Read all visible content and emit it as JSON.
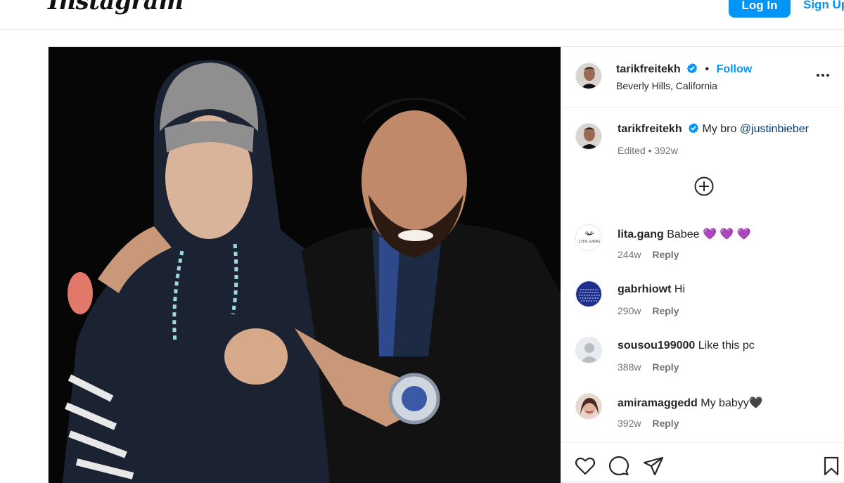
{
  "header": {
    "logo_text": "Instagram",
    "login_label": "Log In",
    "signup_label": "Sign Up"
  },
  "post": {
    "username": "tarikfreitekh",
    "verified": true,
    "follow_label": "Follow",
    "separator": "•",
    "location": "Beverly Hills, California",
    "caption": {
      "username": "tarikfreitekh",
      "text": "My bro",
      "mention": "@justinbieber",
      "edited_label": "Edited",
      "time": "392w"
    }
  },
  "comments": [
    {
      "username": "lita.gang",
      "text": "Babee",
      "emoji": "💜 💜 💜",
      "time": "244w",
      "reply_label": "Reply",
      "avatar_text": "LITA GANG"
    },
    {
      "username": "gabrhiowt",
      "text": "Hi",
      "emoji": "",
      "time": "290w",
      "reply_label": "Reply"
    },
    {
      "username": "sousou199000",
      "text": "Like this pc",
      "emoji": "",
      "time": "388w",
      "reply_label": "Reply"
    },
    {
      "username": "amiramaggedd",
      "text": "My babyy",
      "emoji": "🖤",
      "time": "392w",
      "reply_label": "Reply"
    }
  ],
  "icons": {
    "more": "more-options-icon",
    "load_more": "plus-circle-icon",
    "like": "heart-icon",
    "comment": "comment-icon",
    "share": "share-icon",
    "save": "bookmark-icon"
  },
  "colors": {
    "accent": "#0095f6",
    "mention": "#00376b",
    "meta": "#737373"
  }
}
